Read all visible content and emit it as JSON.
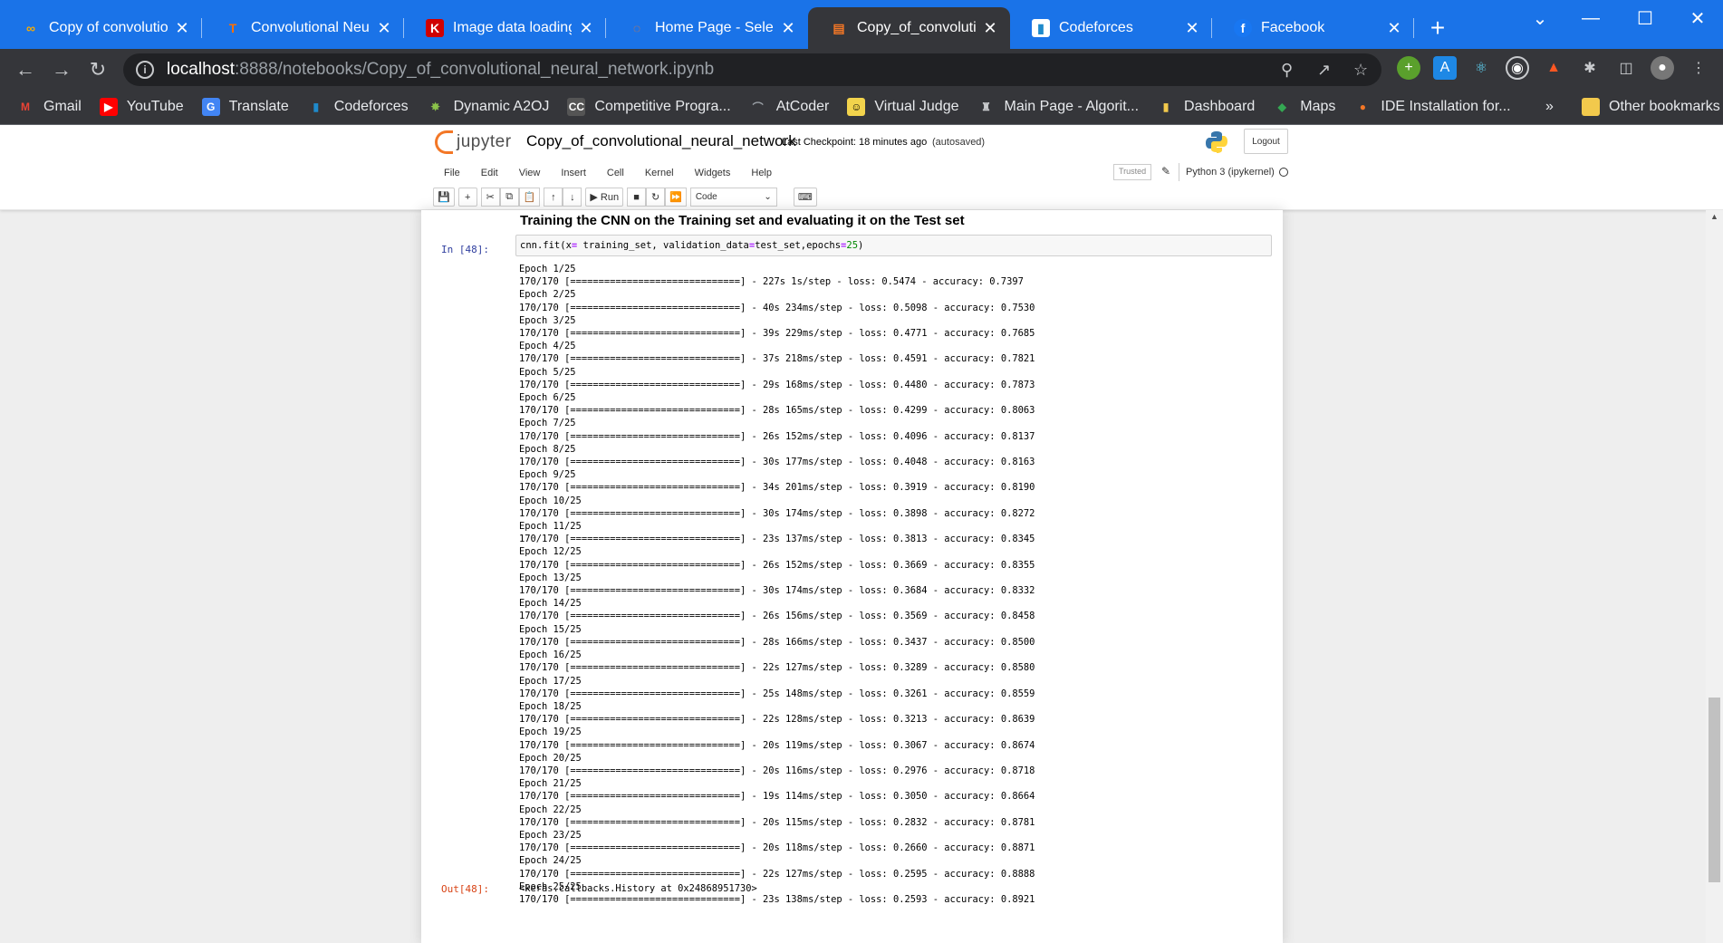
{
  "browser": {
    "tabs": [
      {
        "title": "Copy of convolutiona",
        "icon": "colab-icon",
        "active": false
      },
      {
        "title": "Convolutional Neural",
        "icon": "tensorflow-icon",
        "active": false
      },
      {
        "title": "Image data loading",
        "icon": "keras-icon",
        "active": false
      },
      {
        "title": "Home Page - Select c",
        "icon": "jupyter-icon",
        "active": false
      },
      {
        "title": "Copy_of_convolution",
        "icon": "notebook-icon",
        "active": true
      },
      {
        "title": "Codeforces",
        "icon": "codeforces-icon",
        "active": false
      },
      {
        "title": "Facebook",
        "icon": "facebook-icon",
        "active": false
      }
    ],
    "url_host": "localhost",
    "url_path": ":8888/notebooks/Copy_of_convolutional_neural_network.ipynb",
    "bookmarks": [
      {
        "label": "Gmail",
        "icon": "gmail-icon"
      },
      {
        "label": "YouTube",
        "icon": "youtube-icon"
      },
      {
        "label": "Translate",
        "icon": "translate-icon"
      },
      {
        "label": "Codeforces",
        "icon": "codeforces-icon"
      },
      {
        "label": "Dynamic A2OJ",
        "icon": "a2oj-icon"
      },
      {
        "label": "Competitive Progra...",
        "icon": "cp-icon"
      },
      {
        "label": "AtCoder",
        "icon": "atcoder-icon"
      },
      {
        "label": "Virtual Judge",
        "icon": "vjudge-icon"
      },
      {
        "label": "Main Page - Algorit...",
        "icon": "algorithmica-icon"
      },
      {
        "label": "Dashboard",
        "icon": "dashboard-icon"
      },
      {
        "label": "Maps",
        "icon": "maps-icon"
      },
      {
        "label": "IDE Installation for...",
        "icon": "ide-icon"
      }
    ],
    "bookmarks_overflow": "»",
    "other_bookmarks": "Other bookmarks"
  },
  "jupyter": {
    "logo_text": "jupyter",
    "notebook_name": "Copy_of_convolutional_neural_network",
    "checkpoint": "Last Checkpoint: 18 minutes ago",
    "autosaved": "(autosaved)",
    "logout": "Logout",
    "menu": [
      "File",
      "Edit",
      "View",
      "Insert",
      "Cell",
      "Kernel",
      "Widgets",
      "Help"
    ],
    "trusted": "Trusted",
    "kernel": "Python 3 (ipykernel)",
    "run_label": "Run",
    "cell_type": "Code"
  },
  "cell": {
    "heading": "Training the CNN on the Training set and evaluating it on the Test set",
    "in_prompt": "In [48]:",
    "code_prefix": "cnn.fit(x",
    "code_eq1": "=",
    "code_mid1": " training_set, validation_data",
    "code_eq2": "=",
    "code_mid2": "test_set,epochs",
    "code_eq3": "=",
    "code_num": "25",
    "code_suffix": ")",
    "out_prompt": "Out[48]:",
    "out_value": "<keras.callbacks.History at 0x24868951730>",
    "progress_bar": "[==============================]",
    "steps": "170/170",
    "epochs": [
      {
        "epoch": "Epoch 1/25",
        "time": "227s 1s/step",
        "loss": "0.5474",
        "accuracy": "0.7397"
      },
      {
        "epoch": "Epoch 2/25",
        "time": "40s 234ms/step",
        "loss": "0.5098",
        "accuracy": "0.7530"
      },
      {
        "epoch": "Epoch 3/25",
        "time": "39s 229ms/step",
        "loss": "0.4771",
        "accuracy": "0.7685"
      },
      {
        "epoch": "Epoch 4/25",
        "time": "37s 218ms/step",
        "loss": "0.4591",
        "accuracy": "0.7821"
      },
      {
        "epoch": "Epoch 5/25",
        "time": "29s 168ms/step",
        "loss": "0.4480",
        "accuracy": "0.7873"
      },
      {
        "epoch": "Epoch 6/25",
        "time": "28s 165ms/step",
        "loss": "0.4299",
        "accuracy": "0.8063"
      },
      {
        "epoch": "Epoch 7/25",
        "time": "26s 152ms/step",
        "loss": "0.4096",
        "accuracy": "0.8137"
      },
      {
        "epoch": "Epoch 8/25",
        "time": "30s 177ms/step",
        "loss": "0.4048",
        "accuracy": "0.8163"
      },
      {
        "epoch": "Epoch 9/25",
        "time": "34s 201ms/step",
        "loss": "0.3919",
        "accuracy": "0.8190"
      },
      {
        "epoch": "Epoch 10/25",
        "time": "30s 174ms/step",
        "loss": "0.3898",
        "accuracy": "0.8272"
      },
      {
        "epoch": "Epoch 11/25",
        "time": "23s 137ms/step",
        "loss": "0.3813",
        "accuracy": "0.8345"
      },
      {
        "epoch": "Epoch 12/25",
        "time": "26s 152ms/step",
        "loss": "0.3669",
        "accuracy": "0.8355"
      },
      {
        "epoch": "Epoch 13/25",
        "time": "30s 174ms/step",
        "loss": "0.3684",
        "accuracy": "0.8332"
      },
      {
        "epoch": "Epoch 14/25",
        "time": "26s 156ms/step",
        "loss": "0.3569",
        "accuracy": "0.8458"
      },
      {
        "epoch": "Epoch 15/25",
        "time": "28s 166ms/step",
        "loss": "0.3437",
        "accuracy": "0.8500"
      },
      {
        "epoch": "Epoch 16/25",
        "time": "22s 127ms/step",
        "loss": "0.3289",
        "accuracy": "0.8580"
      },
      {
        "epoch": "Epoch 17/25",
        "time": "25s 148ms/step",
        "loss": "0.3261",
        "accuracy": "0.8559"
      },
      {
        "epoch": "Epoch 18/25",
        "time": "22s 128ms/step",
        "loss": "0.3213",
        "accuracy": "0.8639"
      },
      {
        "epoch": "Epoch 19/25",
        "time": "20s 119ms/step",
        "loss": "0.3067",
        "accuracy": "0.8674"
      },
      {
        "epoch": "Epoch 20/25",
        "time": "20s 116ms/step",
        "loss": "0.2976",
        "accuracy": "0.8718"
      },
      {
        "epoch": "Epoch 21/25",
        "time": "19s 114ms/step",
        "loss": "0.3050",
        "accuracy": "0.8664"
      },
      {
        "epoch": "Epoch 22/25",
        "time": "20s 115ms/step",
        "loss": "0.2832",
        "accuracy": "0.8781"
      },
      {
        "epoch": "Epoch 23/25",
        "time": "20s 118ms/step",
        "loss": "0.2660",
        "accuracy": "0.8871"
      },
      {
        "epoch": "Epoch 24/25",
        "time": "22s 127ms/step",
        "loss": "0.2595",
        "accuracy": "0.8888"
      },
      {
        "epoch": "Epoch 25/25",
        "time": "23s 138ms/step",
        "loss": "0.2593",
        "accuracy": "0.8921"
      }
    ]
  },
  "colors": {
    "chrome_blue": "#1a73e8",
    "chrome_dark": "#35363a",
    "jupyter_orange": "#f37726",
    "in_prompt": "#303f9f",
    "out_prompt": "#d84315"
  }
}
